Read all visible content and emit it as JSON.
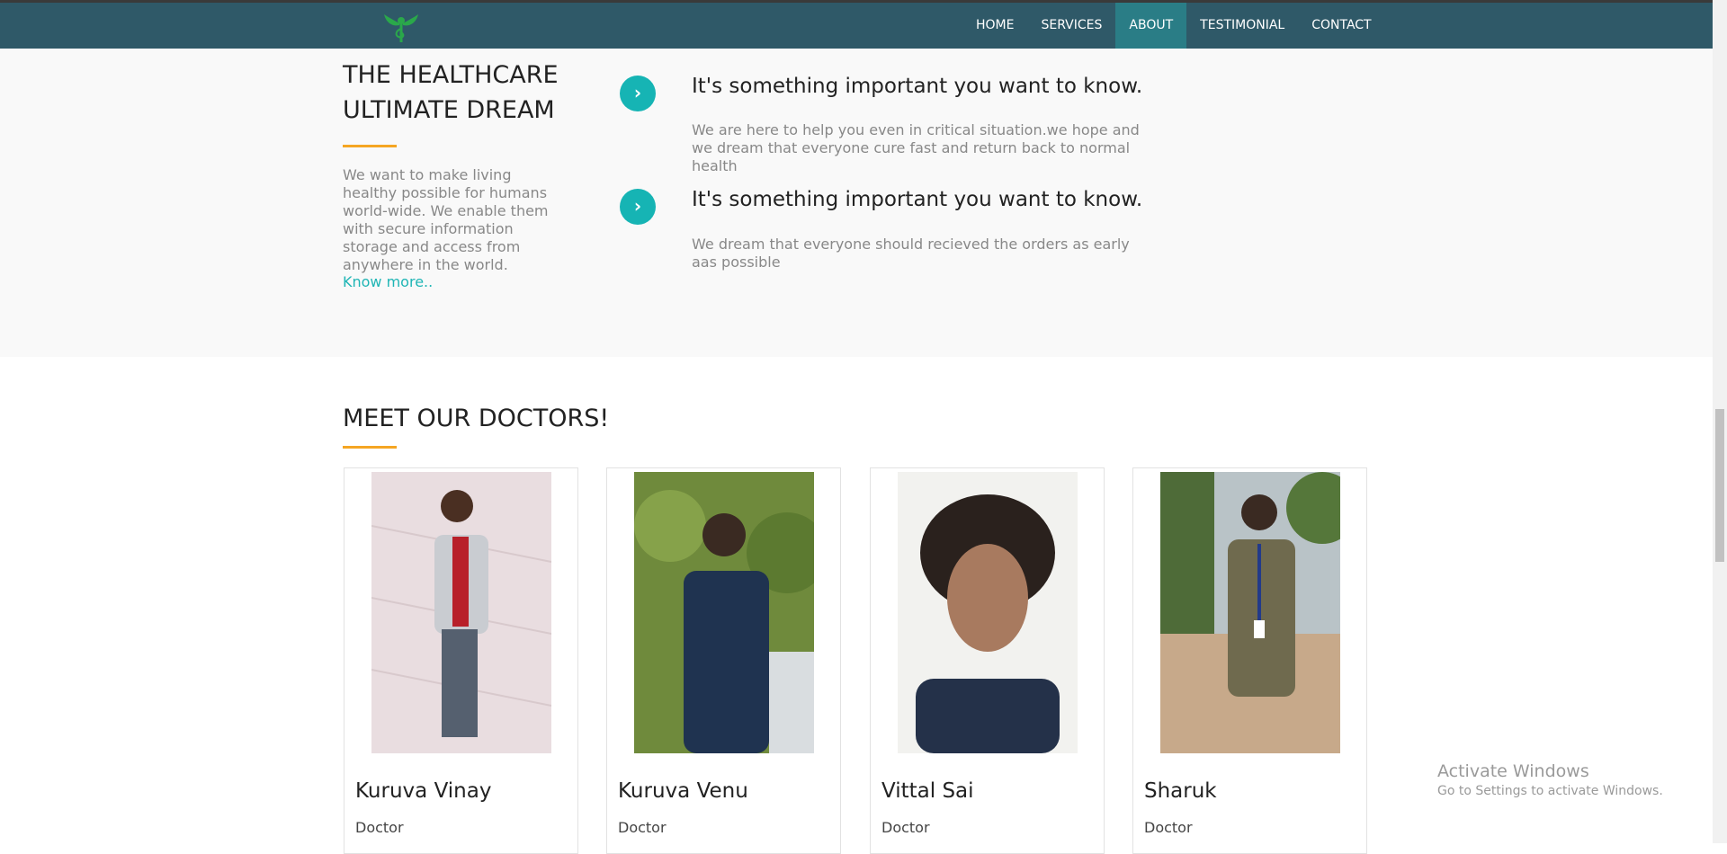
{
  "nav": {
    "logo_icon": "caduceus-leaf-logo",
    "items": [
      {
        "label": "HOME"
      },
      {
        "label": "SERVICES"
      },
      {
        "label": "ABOUT"
      },
      {
        "label": "TESTIMONIAL"
      },
      {
        "label": "CONTACT"
      }
    ],
    "active": "ABOUT"
  },
  "about": {
    "heading": "THE HEALTHCARE ULTIMATE DREAM",
    "description": "We want to make living healthy possible for humans world-wide. We enable them with secure information storage and access from anywhere in the world.",
    "link": "Know more..",
    "features": [
      {
        "icon": "chevron-right-icon",
        "title": "It's something important you want to know.",
        "text": "We are here to help you even in critical situation.we hope and we dream that everyone cure fast and return back to normal health"
      },
      {
        "icon": "chevron-right-icon",
        "title": "It's something important you want to know.",
        "text": "We dream that everyone should recieved the orders as early aas possible"
      }
    ]
  },
  "doctors": {
    "heading": "MEET OUR DOCTORS!",
    "items": [
      {
        "name": "Kuruva Vinay",
        "role": "Doctor"
      },
      {
        "name": "Kuruva Venu",
        "role": "Doctor"
      },
      {
        "name": "Vittal Sai",
        "role": "Doctor"
      },
      {
        "name": "Sharuk",
        "role": "Doctor"
      }
    ]
  },
  "watermark": {
    "title": "Activate Windows",
    "subtitle": "Go to Settings to activate Windows."
  },
  "colors": {
    "navbar": "#2f5968",
    "nav_active": "#2a7d86",
    "accent_teal": "#16b4b4",
    "accent_orange": "#f5a623"
  }
}
